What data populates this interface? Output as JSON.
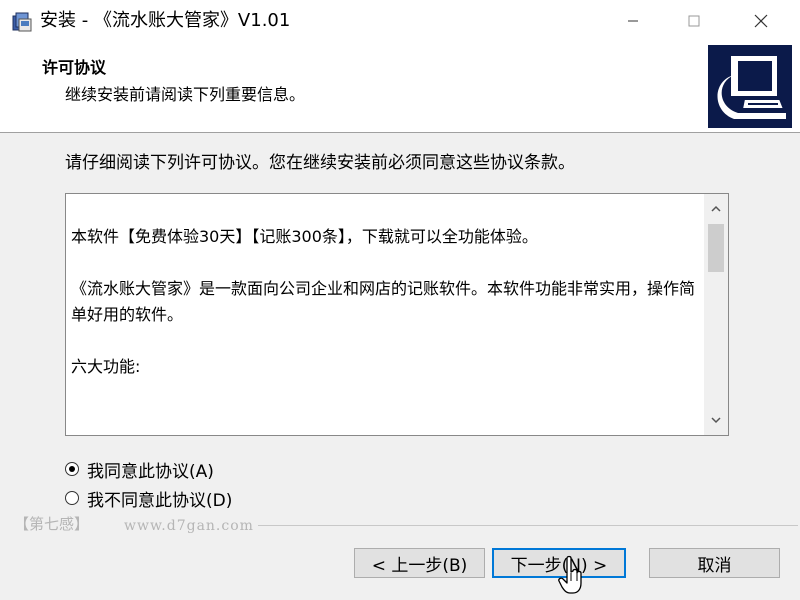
{
  "window": {
    "title": "安装 - 《流水账大管家》V1.01",
    "icon": "installer-app-icon",
    "controls": [
      "minimize-icon",
      "maximize-icon",
      "close-icon"
    ]
  },
  "header": {
    "title": "许可协议",
    "subtitle": "继续安装前请阅读下列重要信息。"
  },
  "intro": "请仔细阅读下列许可协议。您在继续安装前必须同意这些协议条款。",
  "license": {
    "paragraphs": [
      "本软件【免费体验30天】【记账300条】，下载就可以全功能体验。",
      "《流水账大管家》是一款面向公司企业和网店的记账软件。本软件功能非常实用，操作简单好用的软件。",
      "六大功能:"
    ]
  },
  "options": {
    "accept": "我同意此协议(A)",
    "decline": "我不同意此协议(D)",
    "selected": "accept"
  },
  "watermark": {
    "brand": "【第七感】",
    "url": "www.d7gan.com"
  },
  "buttons": {
    "back": "< 上一步(B)",
    "next": "下一步(N) >",
    "cancel": "取消"
  },
  "colors": {
    "accent_border": "#0078d7",
    "logo_background": "#0b1a4a",
    "window_background": "#f0f0f0"
  }
}
